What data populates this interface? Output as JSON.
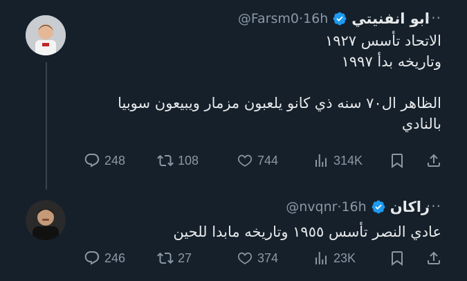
{
  "tweets": [
    {
      "name": "ابو انفنيتي",
      "handle": "@Farsm0",
      "separator": "·",
      "time": "16h",
      "more": "···",
      "paragraphs": [
        "الاتحاد تأسس ١٩٢٧\nوتاريخه بدأ ١٩٩٧",
        "الظاهر ال٧٠ سنه ذي كانو يلعبون مزمار ويبيعون سوبيا بالنادي"
      ],
      "replies": "248",
      "retweets": "108",
      "likes": "744",
      "views": "314K"
    },
    {
      "name": "راكان",
      "handle": "@nvqnr",
      "separator": "·",
      "time": "16h",
      "more": "···",
      "paragraphs": [
        "عادي النصر تأسس ١٩٥٥ وتاريخه مابدا للحين"
      ],
      "replies": "246",
      "retweets": "27",
      "likes": "374",
      "views": "23K"
    }
  ],
  "colors": {
    "background": "#15202b",
    "text": "#e7e9ea",
    "muted": "#8b98a5",
    "verified": "#1d9bf0",
    "thread_line": "#38444d"
  },
  "icons": [
    "avatar",
    "verified-badge-icon",
    "more-icon",
    "reply-icon",
    "retweet-icon",
    "like-icon",
    "views-icon",
    "bookmark-icon",
    "share-icon"
  ]
}
